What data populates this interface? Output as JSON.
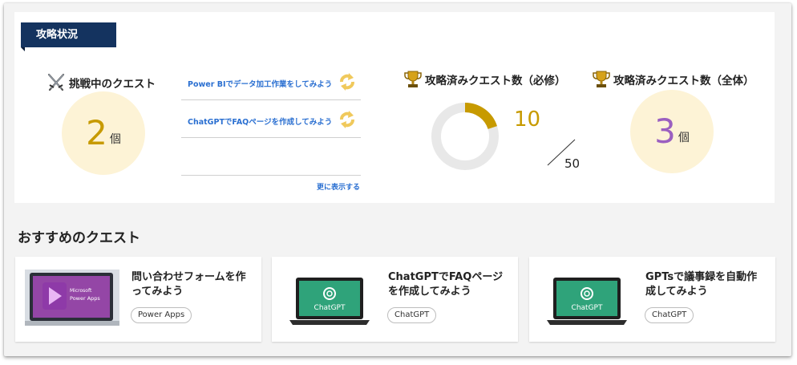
{
  "status": {
    "tag_label": "攻略状況",
    "in_progress": {
      "title": "挑戦中のクエスト",
      "count": "2",
      "unit": "個",
      "quests": [
        {
          "label": "Power BIでデータ加工作業をしてみよう"
        },
        {
          "label": "ChatGPTでFAQページを作成してみよう"
        }
      ],
      "more_label": "更に表示する"
    },
    "required": {
      "title": "攻略済みクエスト数（必修）",
      "done": "10",
      "total": "50",
      "progress": 0.2
    },
    "overall": {
      "title": "攻略済みクエスト数（全体）",
      "count": "3",
      "unit": "個"
    }
  },
  "recommended": {
    "title": "おすすめのクエスト",
    "cards": [
      {
        "title": "問い合わせフォームを作ってみよう",
        "tag": "Power Apps",
        "thumb_text": [
          "Microsoft",
          "Power Apps"
        ]
      },
      {
        "title": "ChatGPTでFAQページを作成してみよう",
        "tag": "ChatGPT",
        "thumb_text": "ChatGPT"
      },
      {
        "title": "GPTsで議事録を自動作成してみよう",
        "tag": "ChatGPT",
        "thumb_text": "ChatGPT"
      }
    ]
  },
  "colors": {
    "navy": "#14335f",
    "gold": "#c79a00",
    "link": "#2a6fd1",
    "purple": "#9b5fc0",
    "cream": "#fdf3d6",
    "chatgpt_green": "#2fa37a"
  }
}
